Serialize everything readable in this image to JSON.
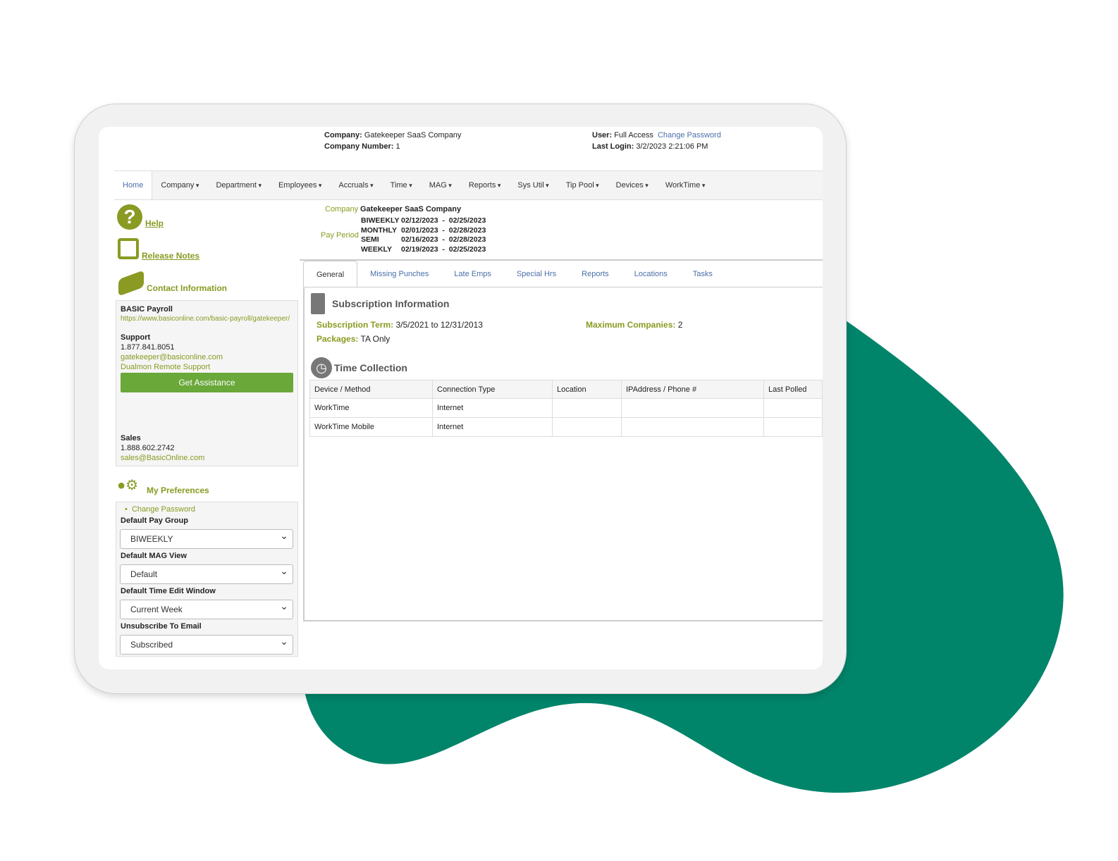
{
  "header": {
    "company_label": "Company:",
    "company": "Gatekeeper SaaS Company",
    "number_label": "Company Number:",
    "number": "1",
    "user_label": "User:",
    "user": "Full Access",
    "change_password": "Change Password",
    "last_login_label": "Last Login:",
    "last_login": "3/2/2023 2:21:06 PM"
  },
  "nav": [
    "Home",
    "Company",
    "Department",
    "Employees",
    "Accruals",
    "Time",
    "MAG",
    "Reports",
    "Sys Util",
    "Tip Pool",
    "Devices",
    "WorkTime"
  ],
  "sidebar": {
    "help": "Help",
    "release_notes": "Release Notes",
    "contact_title": "Contact Information",
    "basic": "BASIC Payroll",
    "url": "https://www.basiconline.com/basic-payroll/gatekeeper/",
    "support": "Support",
    "support_phone": "1.877.841.8051",
    "support_email": "gatekeeper@basiconline.com",
    "remote": "Dualmon Remote Support",
    "assist": "Get Assistance",
    "sales": "Sales",
    "sales_phone": "1.888.602.2742",
    "sales_email": "sales@BasicOnline.com",
    "prefs_title": "My Preferences",
    "change_password": "Change Password",
    "pay_group_label": "Default Pay Group",
    "pay_group": "BIWEEKLY",
    "mag_label": "Default MAG View",
    "mag": "Default",
    "time_label": "Default Time Edit Window",
    "time": "Current Week",
    "email_label": "Unsubscribe To Email",
    "email": "Subscribed"
  },
  "summary": {
    "company_label": "Company",
    "company": "Gatekeeper SaaS Company",
    "pay_period_label": "Pay Period",
    "periods": [
      {
        "name": "BIWEEKLY",
        "start": "02/12/2023",
        "end": "02/25/2023"
      },
      {
        "name": "MONTHLY",
        "start": "02/01/2023",
        "end": "02/28/2023"
      },
      {
        "name": "SEMI",
        "start": "02/16/2023",
        "end": "02/28/2023"
      },
      {
        "name": "WEEKLY",
        "start": "02/19/2023",
        "end": "02/25/2023"
      }
    ]
  },
  "tabs": [
    "General",
    "Missing Punches",
    "Late Emps",
    "Special Hrs",
    "Reports",
    "Locations",
    "Tasks"
  ],
  "subscription": {
    "title": "Subscription Information",
    "term_label": "Subscription Term:",
    "term": "3/5/2021 to 12/31/2013",
    "max_label": "Maximum Companies:",
    "max": "2",
    "packages_label": "Packages:",
    "packages": "TA Only"
  },
  "time_collection": {
    "title": "Time Collection",
    "columns": [
      "Device / Method",
      "Connection Type",
      "Location",
      "IPAddress / Phone #",
      "Last Polled"
    ],
    "rows": [
      [
        "WorkTime",
        "Internet",
        "",
        "",
        ""
      ],
      [
        "WorkTime Mobile",
        "Internet",
        "",
        "",
        ""
      ]
    ]
  },
  "colors": {
    "accent": "#8a9a22",
    "link": "#4a6fa8",
    "blob": "#00846a",
    "button": "#6aa83a"
  }
}
